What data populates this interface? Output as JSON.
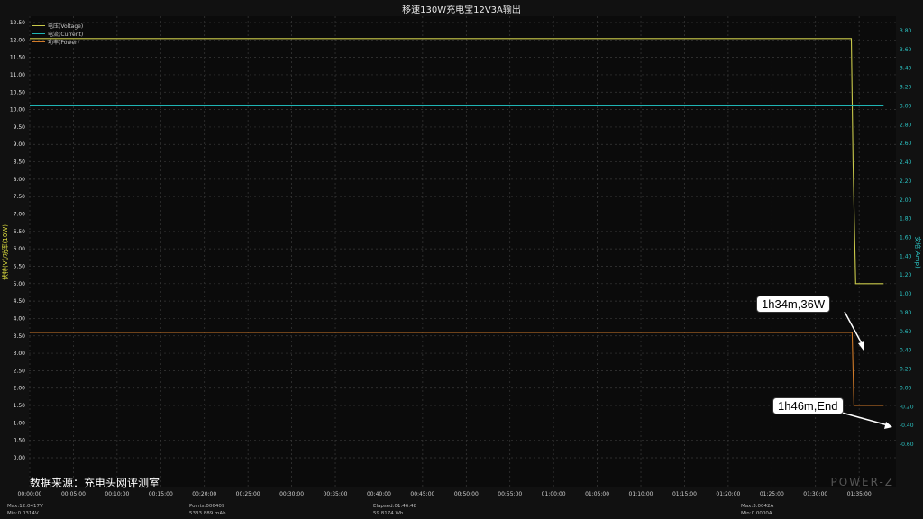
{
  "chart_data": {
    "type": "line",
    "title": "移速130W充电宝12V3A输出",
    "left_axis_label": "伏特(V)/功率(10W)",
    "right_axis_label": "安培(Amp)",
    "x_ticks": [
      "00:00:00",
      "00:05:00",
      "00:10:00",
      "00:15:00",
      "00:20:00",
      "00:25:00",
      "00:30:00",
      "00:35:00",
      "00:40:00",
      "00:45:00",
      "00:50:00",
      "00:55:00",
      "01:00:00",
      "01:05:00",
      "01:10:00",
      "01:15:00",
      "01:20:00",
      "01:25:00",
      "01:30:00",
      "01:35:00"
    ],
    "x_range_min": [
      0,
      100
    ],
    "left_ylim": [
      0,
      12.5
    ],
    "left_ticks": [
      "0.00",
      "0.50",
      "1.00",
      "1.50",
      "2.00",
      "2.50",
      "3.00",
      "3.50",
      "4.00",
      "4.50",
      "5.00",
      "5.50",
      "6.00",
      "6.50",
      "7.00",
      "7.50",
      "8.00",
      "8.50",
      "9.00",
      "9.50",
      "10.00",
      "10.50",
      "11.00",
      "11.50",
      "12.00",
      "12.50"
    ],
    "right_ylim": [
      -0.6,
      3.1
    ],
    "right_ticks": [
      "-0.60",
      "-0.40",
      "-0.20",
      "0.00",
      "0.20",
      "0.40",
      "0.60",
      "0.80",
      "1.00",
      "1.20",
      "1.40",
      "1.60",
      "1.80",
      "2.00",
      "2.20",
      "2.40",
      "2.60",
      "2.80",
      "3.00",
      "3.20",
      "3.40",
      "3.60",
      "3.80"
    ],
    "grid": true,
    "legend_position": "top-left",
    "series": [
      {
        "name": "电压(Voltage)",
        "axis": "left",
        "color": "#c9c94a",
        "points": [
          [
            0,
            12.04
          ],
          [
            94.1,
            12.04
          ],
          [
            94.3,
            8.5
          ],
          [
            94.6,
            5.0
          ],
          [
            97.8,
            5.0
          ]
        ]
      },
      {
        "name": "电流(Current)",
        "axis": "right",
        "color": "#1fb5b5",
        "points": [
          [
            0,
            3.0
          ],
          [
            97.8,
            3.0
          ]
        ]
      },
      {
        "name": "功率(Power)",
        "axis": "left",
        "color": "#d07a28",
        "points": [
          [
            0,
            3.6
          ],
          [
            94.2,
            3.6
          ],
          [
            94.4,
            1.5
          ],
          [
            97.8,
            1.5
          ]
        ]
      }
    ],
    "annotations": [
      {
        "text": "1h34m,36W"
      },
      {
        "text": "1h46m,End"
      }
    ]
  },
  "source_text": "数据来源：充电头网评测室",
  "watermark": "POWER-Z",
  "stats": {
    "v_max": "Max:12.0417V",
    "v_min": "Min:0.0314V",
    "points": "Points:006409",
    "mah": "5333.889 mAh",
    "elapsed": "Elapsed:01:46:48",
    "wh": "59.8174 Wh",
    "a_max": "Max:3.0042A",
    "a_min": "Min:0.0000A"
  }
}
